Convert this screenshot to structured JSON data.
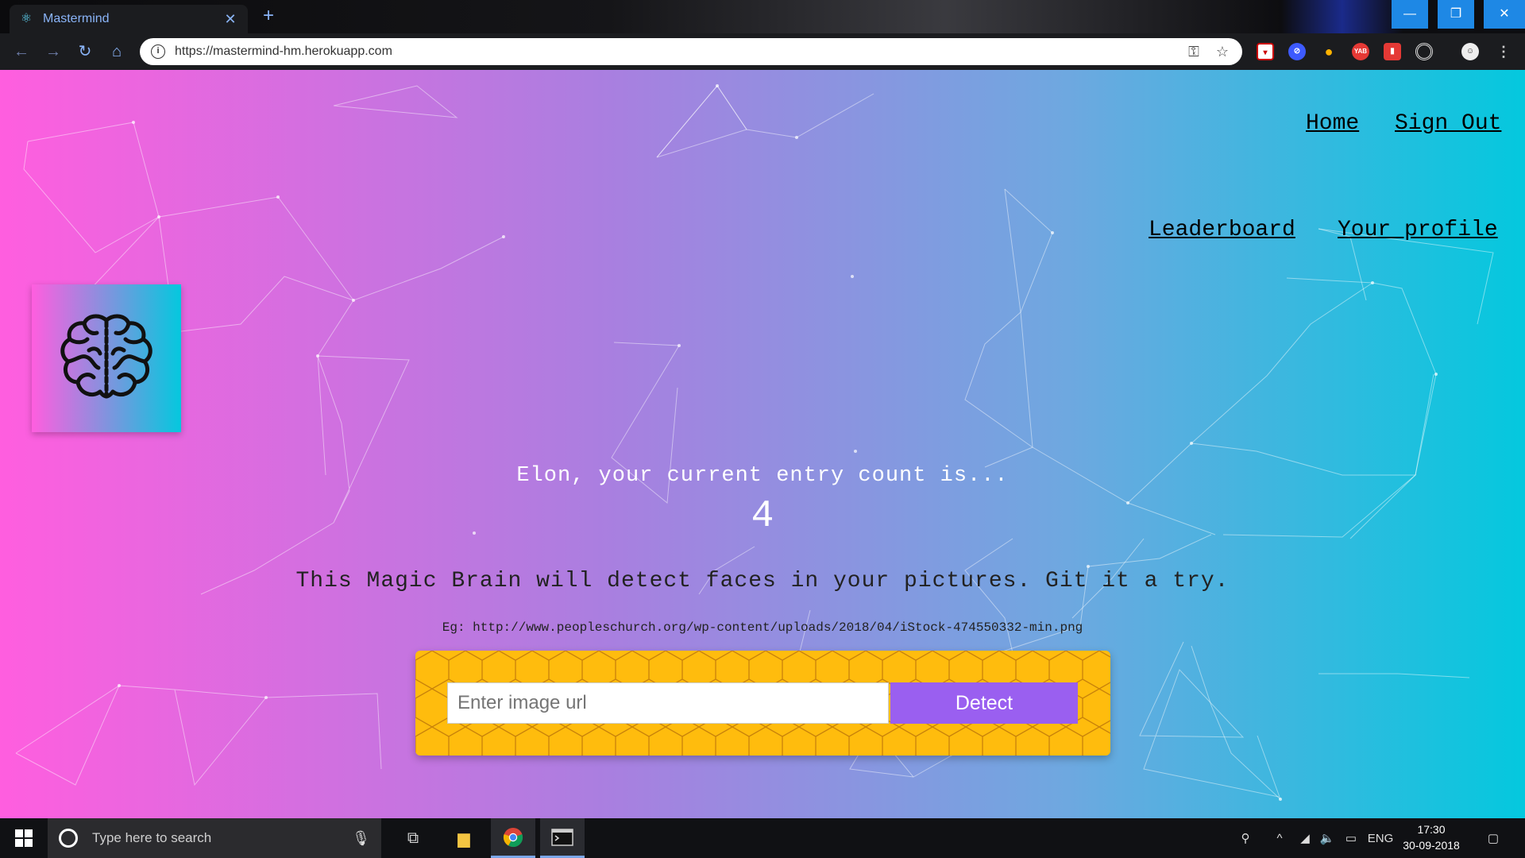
{
  "browser": {
    "tab_title": "Mastermind",
    "tab_close": "✕",
    "new_tab": "+",
    "url": "https://mastermind-hm.herokuapp.com",
    "window_controls": {
      "minimize": "—",
      "restore": "❐",
      "close": "✕"
    },
    "extensions": [
      "pocket-icon",
      "blocker-icon",
      "bulb-icon",
      "yab-icon",
      "book-icon",
      "target-icon",
      "profile-icon",
      "menu-icon"
    ],
    "yab_label": "YAB"
  },
  "page": {
    "nav": {
      "home": "Home",
      "sign_out": "Sign Out",
      "leaderboard": "Leaderboard",
      "profile": "Your profile"
    },
    "entry_text": "Elon, your current entry count is...",
    "entry_count": "4",
    "tagline": "This Magic Brain will detect faces in your pictures. Git it a try.",
    "example": "Eg: http://www.peopleschurch.org/wp-content/uploads/2018/04/iStock-474550332-min.png",
    "input_placeholder": "Enter image url",
    "detect_label": "Detect",
    "colors": {
      "gradient_start": "#ff5edf",
      "gradient_end": "#04c8de",
      "panel": "#ffbc0d",
      "button": "#9a5ff0"
    }
  },
  "taskbar": {
    "search_placeholder": "Type here to search",
    "language": "ENG",
    "time": "17:30",
    "date": "30-09-2018"
  }
}
